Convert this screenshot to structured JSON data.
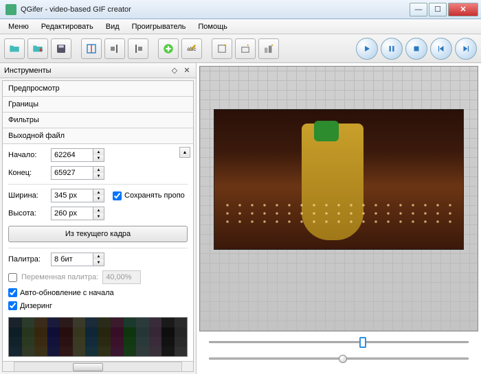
{
  "window": {
    "title": "QGifer - video-based GIF creator"
  },
  "menubar": {
    "items": [
      "Меню",
      "Редактировать",
      "Вид",
      "Проигрыватель",
      "Помощь"
    ]
  },
  "toolbar": {
    "icons": [
      "open-folder",
      "save-gif",
      "save-disk",
      "frame-tool",
      "mark-in",
      "mark-out",
      "add-plus",
      "text-abc",
      "crop",
      "resize",
      "effects"
    ],
    "playback": [
      "play",
      "pause",
      "stop",
      "prev",
      "next"
    ]
  },
  "sidebar": {
    "title": "Инструменты",
    "sections": {
      "preview": "Предпросмотр",
      "borders": "Границы",
      "filters": "Фильтры",
      "output": "Выходной файл"
    },
    "output": {
      "start_label": "Начало:",
      "start_value": "62264",
      "end_label": "Конец:",
      "end_value": "65927",
      "width_label": "Ширина:",
      "width_value": "345 px",
      "height_label": "Высота:",
      "height_value": "260 px",
      "keep_ratio_label": "Сохранять пропо",
      "keep_ratio_checked": true,
      "from_current_frame": "Из текущего кадра",
      "palette_label": "Палитра:",
      "palette_value": "8 бит",
      "var_palette_label": "Переменная палитра:",
      "var_palette_value": "40,00%",
      "var_palette_checked": false,
      "auto_update_label": "Авто-обновление с начала",
      "auto_update_checked": true,
      "dithering_label": "Дизеринг",
      "dithering_checked": true
    },
    "palette_colors": [
      "#1a232b",
      "#2b3b2b",
      "#3a2b1a",
      "#1a1a3a",
      "#2b1a1a",
      "#3a3a2b",
      "#1a2b3a",
      "#2b2b1a",
      "#3a1a2b",
      "#1a3a2b",
      "#2b3a3a",
      "#3a2b3a",
      "#1a1a1a",
      "#2b2b2b",
      "#0e1e26",
      "#26361e",
      "#36260e",
      "#0e0e36",
      "#260e0e",
      "#36361e",
      "#0e2636",
      "#26260e",
      "#360e26",
      "#0e360e",
      "#263636",
      "#362636",
      "#0e0e0e",
      "#262626",
      "#12222a",
      "#2a3a22",
      "#3a2a12",
      "#12123a",
      "#2a1212",
      "#3a3a22",
      "#122a3a",
      "#2a2a12",
      "#3a122a",
      "#123a12",
      "#2a3a3a",
      "#3a2a3a",
      "#121212",
      "#2a2a2a",
      "#162630",
      "#303a26",
      "#3a3016",
      "#16163a",
      "#301616",
      "#3a3a26",
      "#16303a",
      "#303016",
      "#3a1630",
      "#163a16",
      "#303a3a",
      "#3a303a",
      "#161616",
      "#303030"
    ]
  },
  "sliders": {
    "position_pct": 58,
    "speed_pct": 50
  }
}
